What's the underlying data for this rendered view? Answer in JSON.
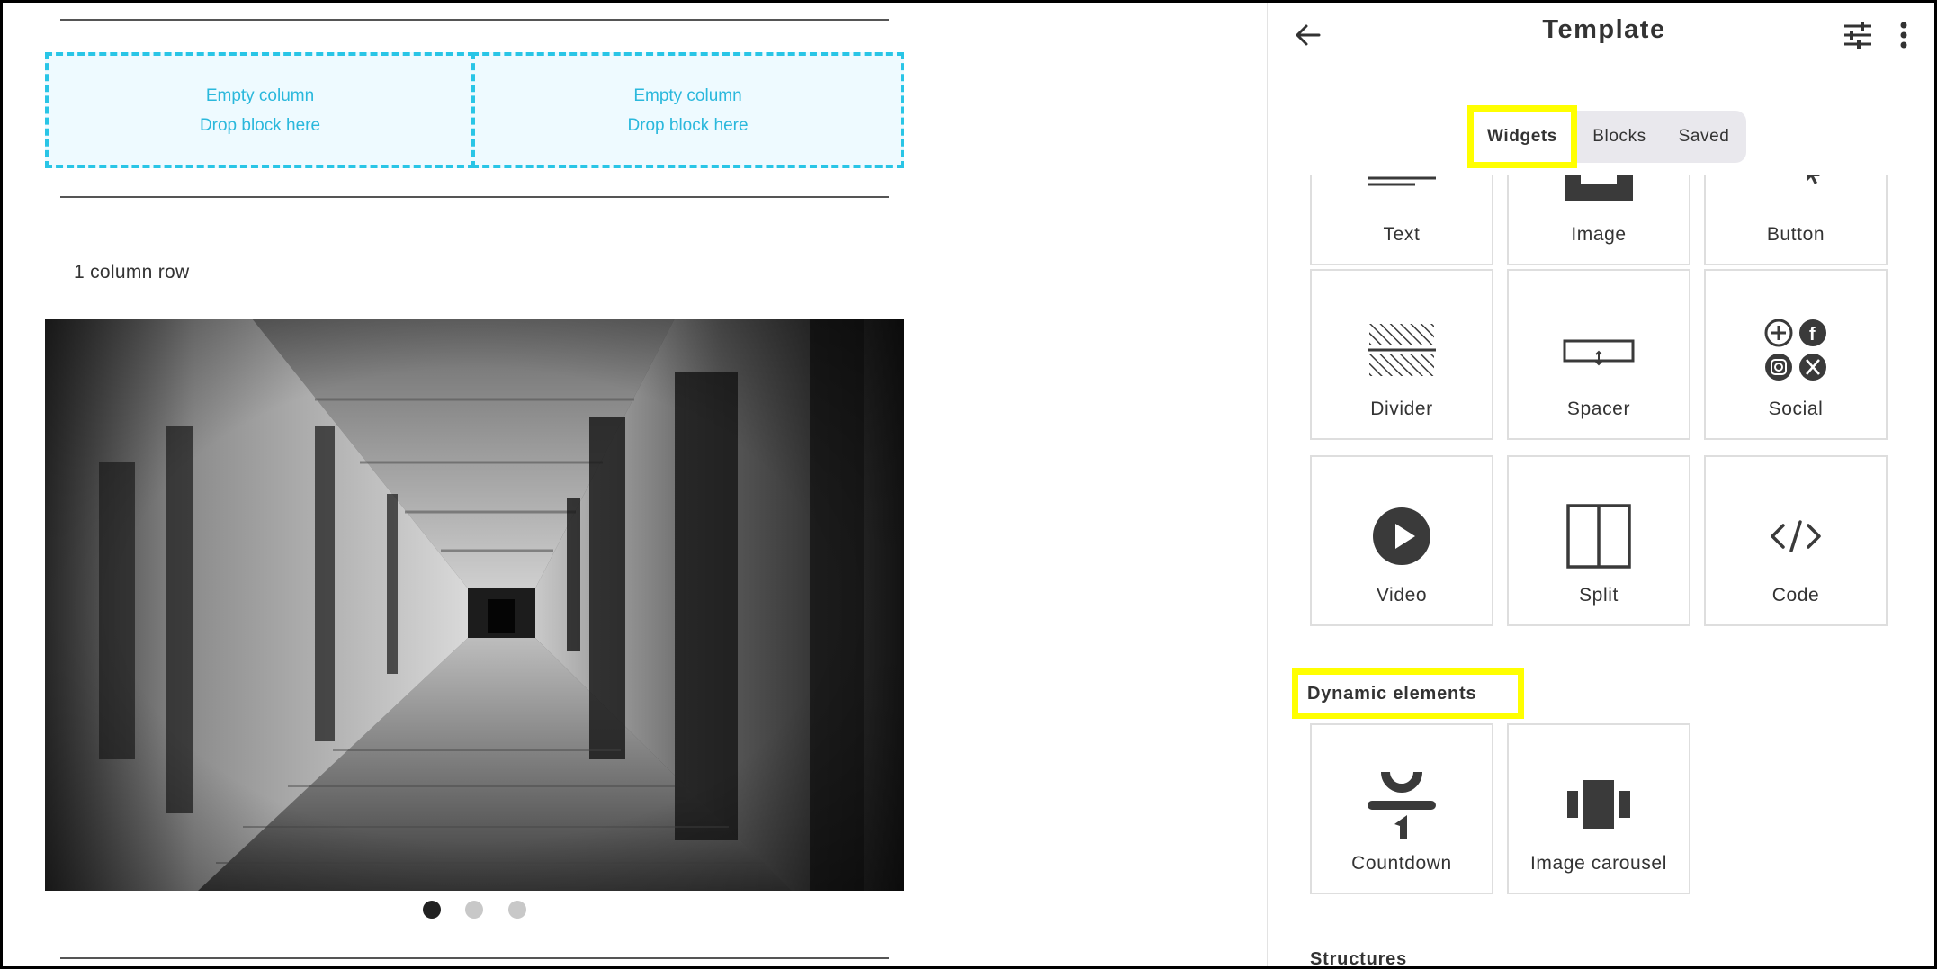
{
  "canvas": {
    "empty_columns": [
      {
        "line1": "Empty column",
        "line2": "Drop block here"
      },
      {
        "line1": "Empty column",
        "line2": "Drop block here"
      }
    ],
    "row_label": "1 column row",
    "hero_image": "corridor-photo",
    "carousel": {
      "count": 3,
      "active_index": 0
    }
  },
  "panel": {
    "title": "Template",
    "icons": {
      "back": "arrow-left-icon",
      "settings": "sliders-icon",
      "more": "more-vertical-icon"
    },
    "tabs": [
      {
        "label": "Widgets",
        "active": true,
        "highlighted": true
      },
      {
        "label": "Blocks",
        "active": false
      },
      {
        "label": "Saved",
        "active": false
      }
    ],
    "widgets": [
      {
        "label": "Text",
        "icon": "text-lines-icon"
      },
      {
        "label": "Image",
        "icon": "image-icon"
      },
      {
        "label": "Button",
        "icon": "button-cursor-icon"
      },
      {
        "label": "Divider",
        "icon": "divider-icon"
      },
      {
        "label": "Spacer",
        "icon": "spacer-icon"
      },
      {
        "label": "Social",
        "icon": "social-icons-icon"
      },
      {
        "label": "Video",
        "icon": "play-circle-icon"
      },
      {
        "label": "Split",
        "icon": "split-columns-icon"
      },
      {
        "label": "Code",
        "icon": "code-brackets-icon"
      }
    ],
    "dynamic_heading": "Dynamic elements",
    "dynamic_widgets": [
      {
        "label": "Countdown",
        "icon": "countdown-icon"
      },
      {
        "label": "Image carousel",
        "icon": "carousel-icon"
      }
    ],
    "structures_heading": "Structures"
  },
  "colors": {
    "highlight": "#ffff00",
    "dropzone_border": "#29c5e6",
    "dropzone_bg": "#eefaff",
    "dropzone_text": "#2ab8dc",
    "icon": "#3a3a3a"
  }
}
